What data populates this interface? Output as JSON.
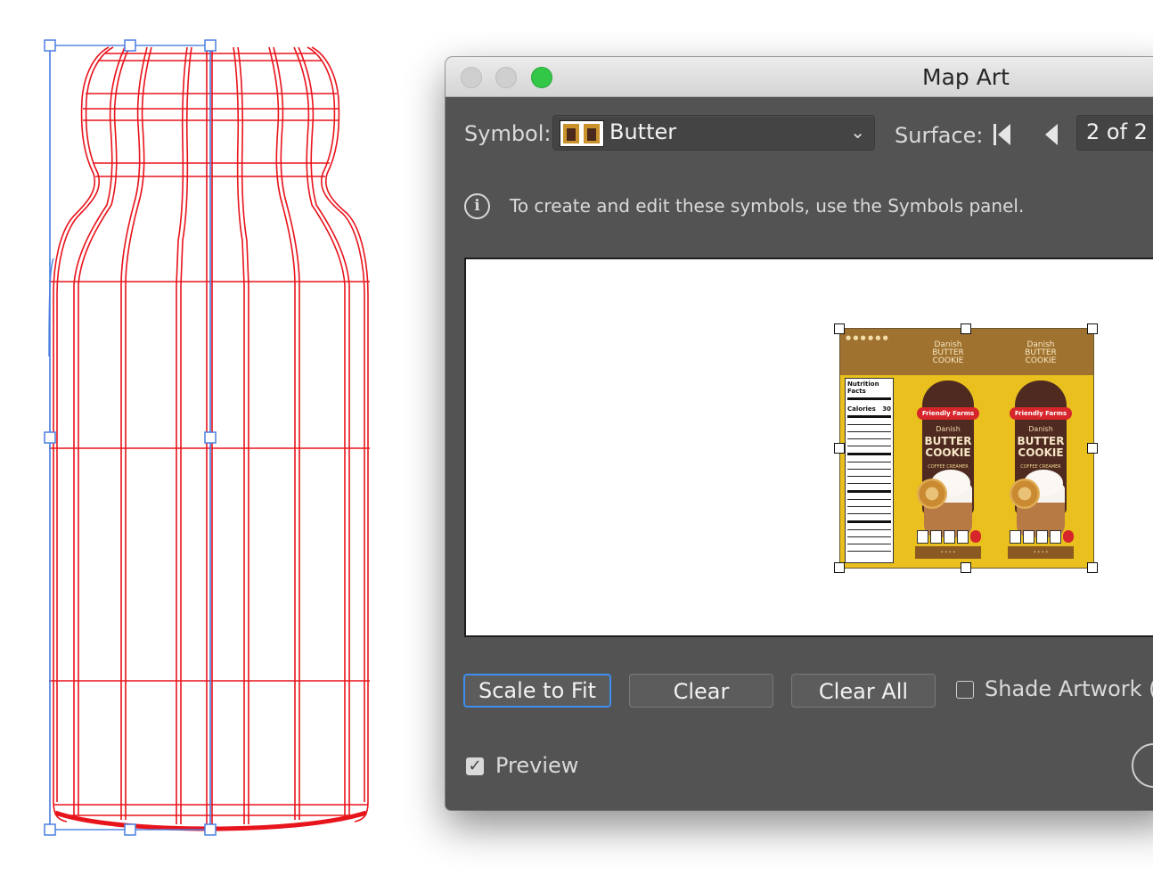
{
  "dialog": {
    "title": "Map Art",
    "symbol_label": "Symbol:",
    "symbol_value": "Butter",
    "surface_label": "Surface:",
    "surface_value": "2 of 2",
    "info_text": "To create and edit these symbols, use the Symbols panel.",
    "buttons": {
      "scale_to_fit": "Scale to Fit",
      "clear": "Clear",
      "clear_all": "Clear All"
    },
    "shade_artwork_label": "Shade Artwork (s",
    "shade_artwork_checked": false,
    "preview_label": "Preview",
    "preview_checked": true
  },
  "label_art": {
    "brand": "Friendly Farms",
    "product_line1": "BUTTER",
    "product_line2": "COOKIE",
    "script_name": "Danish",
    "subtitle": "COFFEE CREAMER",
    "nutrition_title": "Nutrition Facts",
    "calories_label": "Calories",
    "calories_value": "30",
    "band_logo": "Danish BUTTER COOKIE"
  },
  "colors": {
    "wireframe": "#e8141c",
    "selection": "#4a7fe0",
    "dialog_bg": "#535353",
    "focus_ring": "#3d8ef0",
    "zoom_light": "#33c748"
  }
}
